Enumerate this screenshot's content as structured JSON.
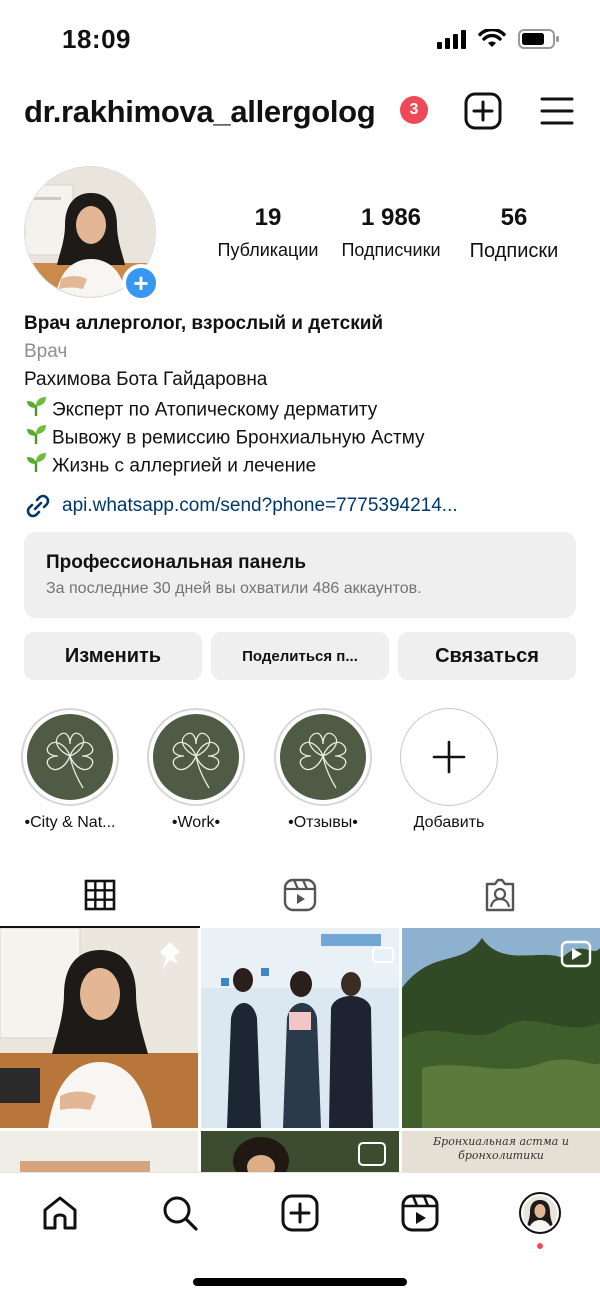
{
  "status": {
    "time": "18:09"
  },
  "header": {
    "username": "dr.rakhimova_allergolog",
    "notifications": "3"
  },
  "stats": [
    {
      "number": "19",
      "label": "Публикации"
    },
    {
      "number": "1 986",
      "label": "Подписчики"
    },
    {
      "number": "56",
      "label": "Подписки"
    }
  ],
  "bio": {
    "name": "Врач аллерголог, взрослый и детский",
    "category": "Врач",
    "lines": [
      "Рахимова Бота Гайдаровна",
      "Эксперт по Атопическому дерматиту",
      "Вывожу в ремиссию Бронхиальную Астму",
      "Жизнь с аллергией и лечение"
    ],
    "link": "api.whatsapp.com/send?phone=7775394214..."
  },
  "pro_panel": {
    "title": "Профессиональная панель",
    "subtitle": "За последние 30 дней вы охватили 486 аккаунтов."
  },
  "actions": {
    "edit": "Изменить",
    "share": "Поделиться п...",
    "contact": "Связаться"
  },
  "highlights": [
    {
      "label": "•City & Nat..."
    },
    {
      "label": "•Work•"
    },
    {
      "label": "•Отзывы•"
    },
    {
      "label": "Добавить"
    }
  ],
  "grid_posts": {
    "post_5_caption": "Бронхиальная астма и бронхолитики"
  },
  "colors": {
    "badge": "#ed4956",
    "link": "#00376b",
    "accent_blue": "#3897f0",
    "highlight_bg": "#4f5b45",
    "panel_bg": "#efefef"
  }
}
